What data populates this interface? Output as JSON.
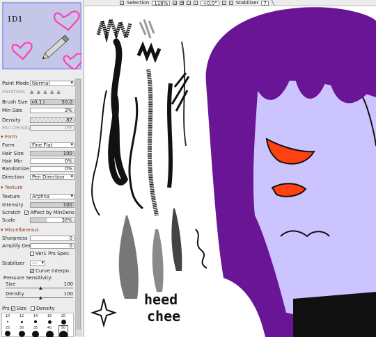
{
  "toolbar": {
    "selection_label": "Selection",
    "zoom": "118%",
    "rotation": "+0.0°",
    "stabilizer_label": "Stabilizer",
    "stabilizer_value": "7"
  },
  "brush_panel": {
    "paint_mode": {
      "label": "Paint Mode",
      "value": "Normal"
    },
    "hardness": {
      "label": "Hardness"
    },
    "brush_size": {
      "label": "Brush Size",
      "multiplier": "x0.1",
      "value": "50.0"
    },
    "min_size": {
      "label": "Min Size",
      "value": "3%"
    },
    "density": {
      "label": "Density",
      "value": "87"
    },
    "min_density": {
      "label": "Min Density",
      "value": "0%"
    }
  },
  "form_section": {
    "title": "Form",
    "form": {
      "label": "Form",
      "value": "Fine Flat"
    },
    "hair_size": {
      "label": "Hair Size",
      "value": "100"
    },
    "hair_min": {
      "label": "Hair Min",
      "value": "0%"
    },
    "randomize": {
      "label": "Randomize",
      "value": "0%"
    },
    "direction": {
      "label": "Direction",
      "value": "Pen Direction"
    }
  },
  "texture_section": {
    "title": "Texture",
    "texture": {
      "label": "Texture",
      "value": "Arpfina"
    },
    "intensity": {
      "label": "Intensity",
      "value": "100"
    },
    "scratch": {
      "label": "Scratch",
      "checkbox": "Affect by MinDens"
    },
    "scale": {
      "label": "Scale",
      "value": "38%"
    }
  },
  "misc_section": {
    "title": "Miscellaneous",
    "sharpness": {
      "label": "Sharpness",
      "value": "0"
    },
    "amplify_density": {
      "label": "Amplify Dens.",
      "value": "0"
    },
    "ver1_prs": "Ver1 Prs Spec.",
    "stabilizer": {
      "label": "Stabilizer",
      "value": "---"
    },
    "curve_interpo": "Curve Interpo.",
    "pressure_sensitivity": "Pressure Sensitivity:",
    "ps_size": {
      "label": "Size",
      "value": "100"
    },
    "ps_density": {
      "label": "Density",
      "value": "100"
    }
  },
  "presets": {
    "prs_label": "Prs",
    "size_label": "Size",
    "density_label": "Density",
    "row1": [
      "10",
      "12",
      "14",
      "16",
      "20"
    ],
    "row2": [
      "25",
      "30",
      "35",
      "40",
      "50"
    ]
  },
  "canvas_text": {
    "line1": "heed",
    "line2": "chee"
  },
  "colors": {
    "purple": "#6a1496",
    "skin": "#ccc4ff",
    "eye_orange": "#ff4010",
    "outline": "#111111",
    "preview_bg": "#c5c7e8",
    "heart_pink": "#ff3fb4"
  }
}
